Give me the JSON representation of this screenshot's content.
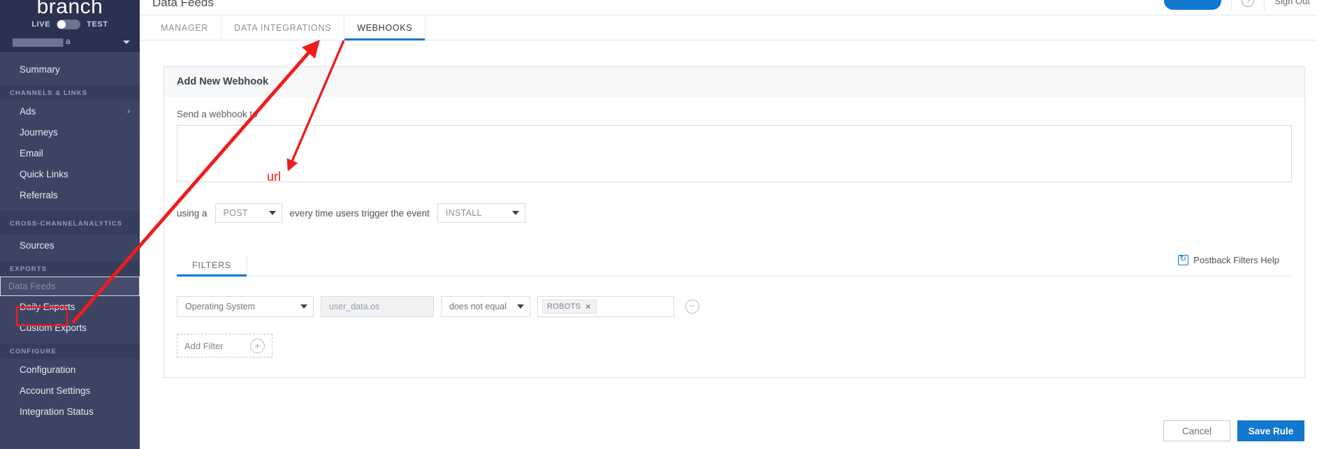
{
  "sidebar": {
    "brand": "branch",
    "env": {
      "live_label": "LIVE",
      "test_label": "TEST",
      "state": "LIVE"
    },
    "app_selector": {
      "value": "a"
    },
    "items": [
      {
        "label": "Summary",
        "type": "link",
        "selected": false
      }
    ],
    "groups": [
      {
        "heading": "CHANNELS & LINKS",
        "items": [
          {
            "label": "Ads",
            "chevron": "›"
          },
          {
            "label": "Journeys"
          },
          {
            "label": "Email"
          },
          {
            "label": "Quick Links"
          },
          {
            "label": "Referrals"
          }
        ]
      },
      {
        "heading": "CROSS-CHANNEL ANALYTICS",
        "heading_line1": "CROSS-CHANNEL",
        "heading_line2": "ANALYTICS",
        "items": [
          {
            "label": "Sources"
          }
        ]
      },
      {
        "heading": "EXPORTS",
        "items": [
          {
            "label": "Data Feeds",
            "selected": true,
            "highlighted": true
          },
          {
            "label": "Daily Exports"
          },
          {
            "label": "Custom Exports"
          }
        ]
      },
      {
        "heading": "CONFIGURE",
        "items": [
          {
            "label": "Configuration"
          },
          {
            "label": "Account Settings"
          },
          {
            "label": "Integration Status"
          }
        ]
      }
    ]
  },
  "topbar": {
    "page_title": "Data Feeds",
    "help_icon": "?",
    "sign_out_label": "Sign Out"
  },
  "tabs": [
    {
      "label": "MANAGER",
      "active": false
    },
    {
      "label": "DATA INTEGRATIONS",
      "active": false
    },
    {
      "label": "WEBHOOKS",
      "active": true
    }
  ],
  "card": {
    "title": "Add New Webhook",
    "url_field": {
      "label": "Send a webhook to",
      "value": "",
      "placeholder": ""
    },
    "verb_row": {
      "prefix": "using a",
      "method": "POST",
      "middle": "every time users trigger the event",
      "event": "INSTALL"
    },
    "postback_help": {
      "label": "Postback Filters Help",
      "icon": "postback-icon"
    },
    "filters_tabs": [
      {
        "label": "FILTERS",
        "active": true
      }
    ],
    "filter_rows": [
      {
        "dimension": "Operating System",
        "field": "user_data.os",
        "operator": "does not equal",
        "values": [
          "ROBOTS"
        ],
        "remove_label": "−"
      }
    ],
    "add_filter": {
      "label": "Add Filter",
      "icon": "plus-icon"
    }
  },
  "footer": {
    "cancel_label": "Cancel",
    "save_label": "Save Rule"
  },
  "annotations": {
    "url_note": "url",
    "color": "#ee1d1d"
  }
}
